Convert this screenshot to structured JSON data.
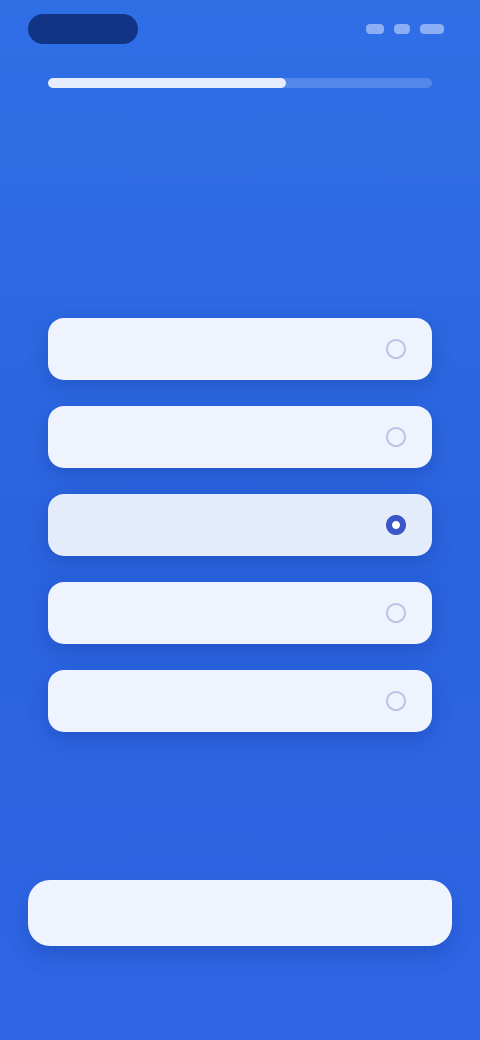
{
  "header": {
    "progress": 0.62
  },
  "question": {
    "title": "",
    "subtitle": ""
  },
  "options": [
    {
      "label": "",
      "selected": false
    },
    {
      "label": "",
      "selected": false
    },
    {
      "label": "",
      "tag": "",
      "selected": true
    },
    {
      "label": "",
      "selected": false
    },
    {
      "label": "",
      "selected": false
    }
  ],
  "footer": {
    "continue_label": ""
  },
  "colors": {
    "background": "#2f6fe6",
    "card": "#eef3fd",
    "accent": "#3a56c9"
  }
}
